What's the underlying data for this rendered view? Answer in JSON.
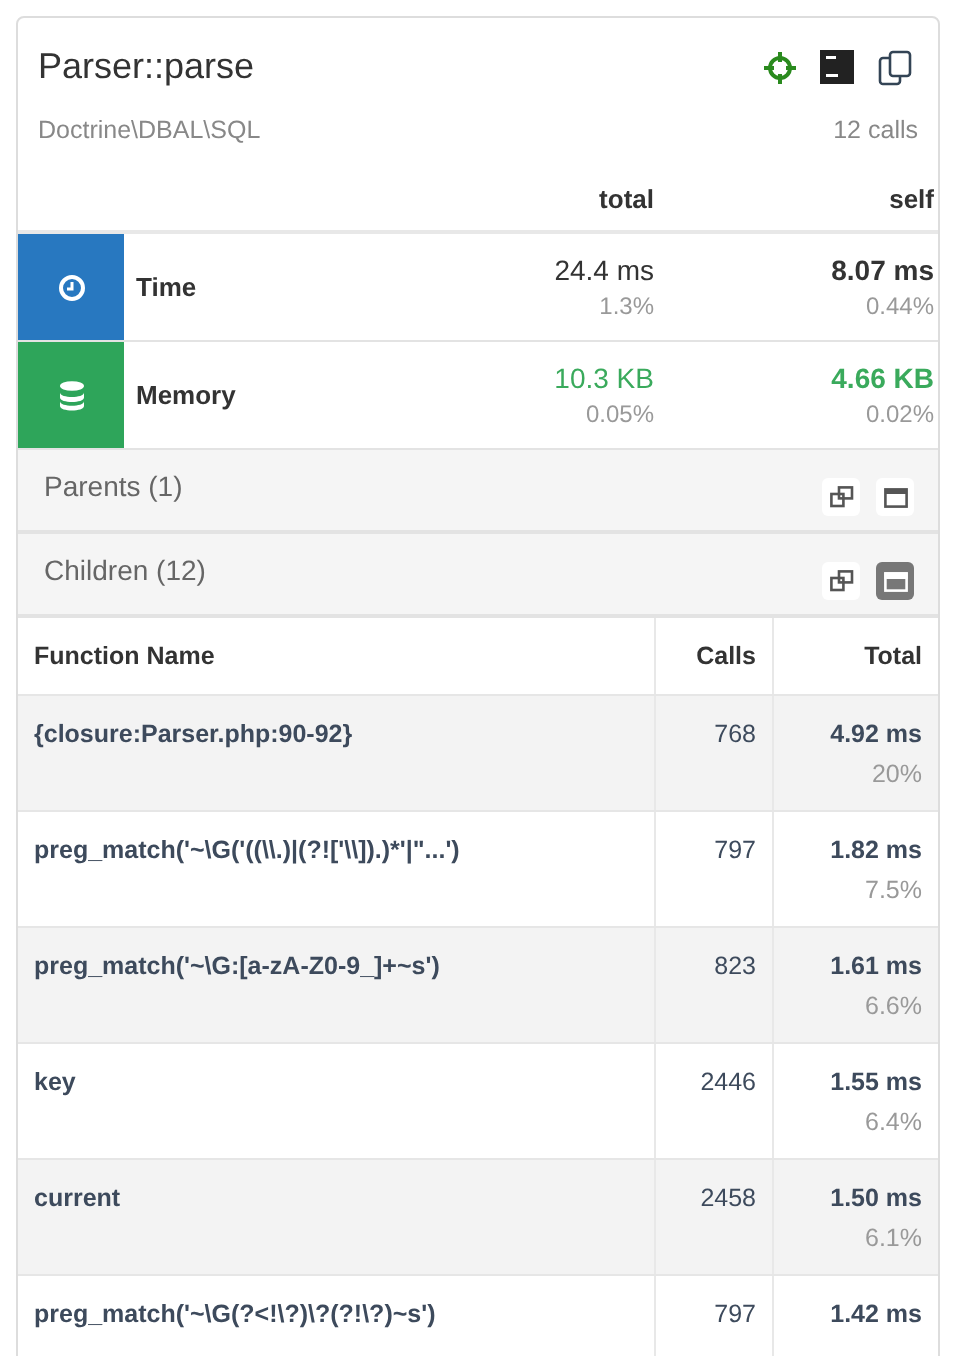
{
  "header": {
    "title": "Parser::parse",
    "namespace": "Doctrine\\DBAL\\SQL",
    "calls": "12 calls"
  },
  "metrics": {
    "columns": [
      "total",
      "self"
    ],
    "rows": [
      {
        "kind": "time",
        "label": "Time",
        "total": "24.4 ms",
        "total_pct": "1.3%",
        "self": "8.07 ms",
        "self_pct": "0.44%"
      },
      {
        "kind": "memory",
        "label": "Memory",
        "total": "10.3 KB",
        "total_pct": "0.05%",
        "self": "4.66 KB",
        "self_pct": "0.02%"
      }
    ]
  },
  "sections": [
    {
      "label": "Parents (1)",
      "expanded": false
    },
    {
      "label": "Children (12)",
      "expanded": true
    }
  ],
  "table": {
    "columns": [
      "Function Name",
      "Calls",
      "Total"
    ],
    "rows": [
      {
        "name": "{closure:Parser.php:90-92}",
        "calls": "768",
        "time": "4.92 ms",
        "pct": "20%"
      },
      {
        "name": "preg_match('~\\G('((\\\\.)|(?!['\\\\]).)*'|\"...')",
        "calls": "797",
        "time": "1.82 ms",
        "pct": "7.5%"
      },
      {
        "name": "preg_match('~\\G:[a-zA-Z0-9_]+~s')",
        "calls": "823",
        "time": "1.61 ms",
        "pct": "6.6%"
      },
      {
        "name": "key",
        "calls": "2446",
        "time": "1.55 ms",
        "pct": "6.4%"
      },
      {
        "name": "current",
        "calls": "2458",
        "time": "1.50 ms",
        "pct": "6.1%"
      },
      {
        "name": "preg_match('~\\G(?<!\\?)\\?(?!\\?)~s')",
        "calls": "797",
        "time": "1.42 ms"
      }
    ]
  }
}
